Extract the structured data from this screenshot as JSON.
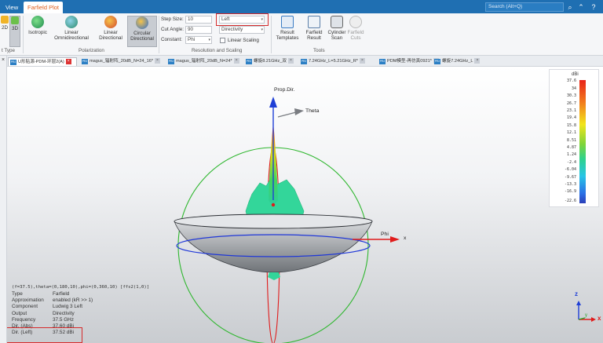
{
  "topbar": {
    "tabs": [
      "View",
      "Farfield Plot"
    ],
    "search_placeholder": "Search (Alt+Q)"
  },
  "ribbon": {
    "dim_buttons": [
      "2D",
      "3D"
    ],
    "plot_type_group": "t Type",
    "polarization_buttons": [
      "Isotropic",
      "Linear Omnidirectional",
      "Linear Directional",
      "Circular Directional"
    ],
    "polarization_group": "Polarization",
    "step_size_label": "Step Size:",
    "step_size_value": "10",
    "cut_angle_label": "Cut Angle:",
    "cut_angle_value": "90",
    "constant_label": "Constant:",
    "constant_value": "Phi",
    "polarization_select": "Left",
    "quantity_select": "Directivity",
    "linear_scaling_label": "Linear Scaling",
    "resolution_group": "Resolution and Scaling",
    "tool_buttons": [
      "Result Templates",
      "Farfield Result",
      "Cylinder Scan",
      "Farfield Cuts"
    ],
    "tools_group": "Tools"
  },
  "doc_tabs": [
    "U形贴源-PDM-环层2(A)",
    "magus_辐射阵_20dB_N=24_16*",
    "magus_辐射阵_20dB_N=24*",
    "螺旋8.21GHz_双",
    "7.24GHz_L=5.21GHz_R*",
    "PDM模型-再仿真0921*",
    "螺旋7.24GHz_L"
  ],
  "viewport": {
    "prop_dir_label": "Prop.Dir.",
    "theta_label": "Theta",
    "phi_label": "Phi",
    "axis_x": "x",
    "axis_z": "z",
    "axis_y": "y"
  },
  "colorbar": {
    "unit": "dBi",
    "ticks": [
      "37.6",
      "34",
      "30.3",
      "26.7",
      "23.1",
      "19.4",
      "15.8",
      "12.1",
      "8.51",
      "4.87",
      "1.24",
      "-2.4",
      "-6.04",
      "-9.67",
      "-13.3",
      "-16.9",
      "-22.6"
    ]
  },
  "info": {
    "header": "(f=37.5),theta=(0,180,10),phi=(0,360,10) [ffs2(1,0)]",
    "rows": [
      {
        "k": "Type",
        "v": "Farfield"
      },
      {
        "k": "Approximation",
        "v": "enabled (kR >> 1)"
      },
      {
        "k": "Component",
        "v": "Ludwig 3 Left"
      },
      {
        "k": "Output",
        "v": "Directivity"
      },
      {
        "k": "Frequency",
        "v": "37.5 GHz"
      },
      {
        "k": "Dir. (Abs)",
        "v": "37.60 dBi"
      },
      {
        "k": "Dir. (Left)",
        "v": "37.52 dBi"
      }
    ]
  },
  "colors": {
    "accent": "#1f6fb2",
    "highlight": "#d62b2b",
    "x_axis": "#e01b1b",
    "z_axis": "#1f3fd6",
    "y_axis": "#2aa52a"
  }
}
